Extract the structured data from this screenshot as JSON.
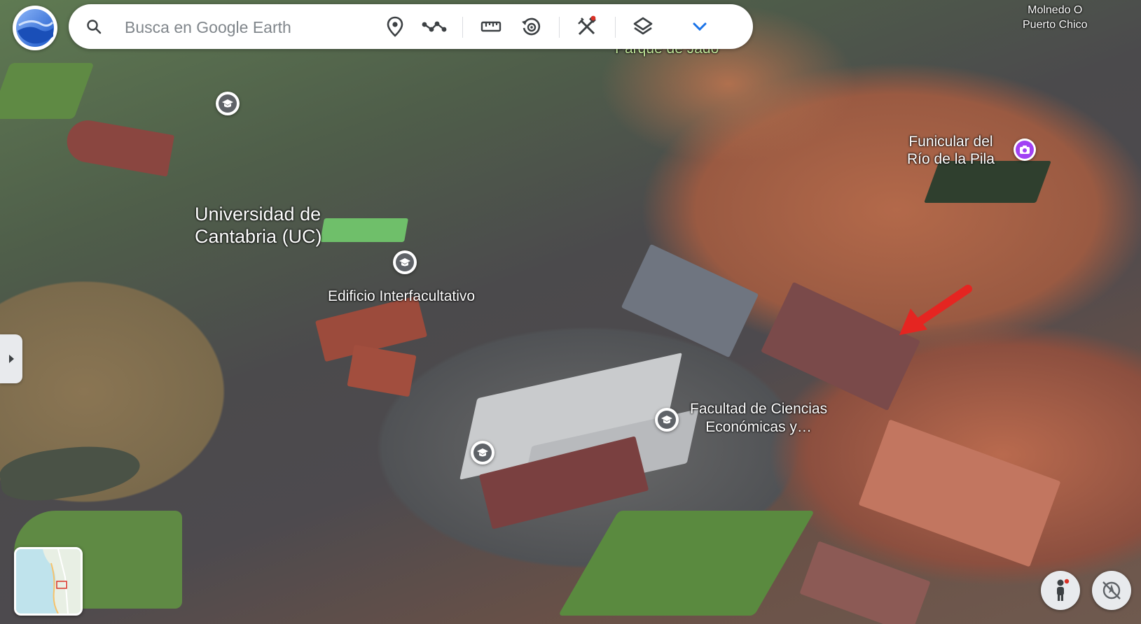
{
  "search": {
    "placeholder": "Busca en Google Earth"
  },
  "map_labels": {
    "universidad": "Universidad de Cantabria (UC)",
    "universidad_line1": "Universidad de",
    "universidad_line2": "Cantabria (UC)",
    "edificio": "Edificio Interfacultativo",
    "facultad_line1": "Facultad de Ciencias",
    "facultad_line2": "Económicas y…",
    "funicular_line1": "Funicular del",
    "funicular_line2": "Río de la Pila",
    "parque": "Parque de Jado",
    "molnedo_line1": "Molnedo O",
    "molnedo_line2": "Puerto Chico"
  },
  "icons": {
    "logo": "google-earth-logo-icon",
    "search": "search-icon",
    "place": "map-pin-icon",
    "path": "path-icon",
    "measure": "ruler-icon",
    "history": "history-icon",
    "projects": "projects-icon",
    "layers": "layers-icon",
    "expand": "chevron-down-icon",
    "school": "school-icon",
    "camera": "camera-icon",
    "pegman": "pegman-icon",
    "compass": "compass-icon"
  },
  "colors": {
    "accent": "#1a73e8",
    "notification": "#d93025",
    "camera_pin": "#a142f4",
    "school_pin": "#5f6368"
  }
}
